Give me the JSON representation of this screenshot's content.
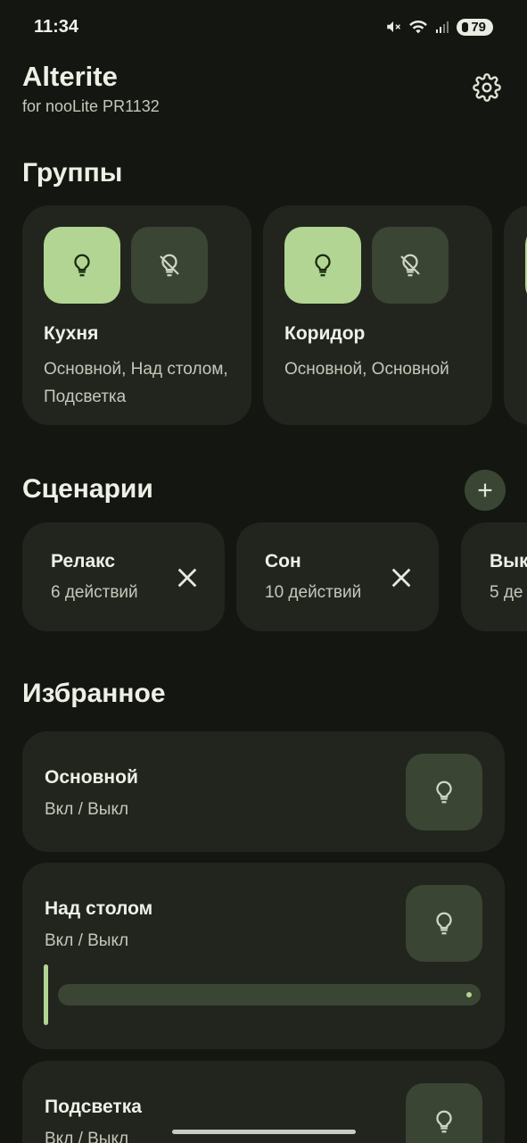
{
  "status_bar": {
    "time": "11:34",
    "battery": "79"
  },
  "header": {
    "title": "Alterite",
    "subtitle": "for nooLite PR1132"
  },
  "groups": {
    "title": "Группы",
    "items": [
      {
        "name": "Кухня",
        "devices": "Основной, Над столом, Подсветка"
      },
      {
        "name": "Коридор",
        "devices": "Основной, Основной"
      }
    ]
  },
  "scenarios": {
    "title": "Сценарии",
    "items": [
      {
        "name": "Релакс",
        "count": "6 действий"
      },
      {
        "name": "Сон",
        "count": "10 действий"
      },
      {
        "name": "Вык",
        "count": "5 де"
      }
    ]
  },
  "favorites": {
    "title": "Избранное",
    "items": [
      {
        "name": "Основной",
        "state": "Вкл / Выкл"
      },
      {
        "name": "Над столом",
        "state": "Вкл / Выкл",
        "brightness": 0
      },
      {
        "name": "Подсветка",
        "state": "Вкл / Выкл"
      }
    ]
  },
  "colors": {
    "background": "#141611",
    "card": "#22251e",
    "accent": "#b2d593",
    "tonal": "#3a4533"
  }
}
